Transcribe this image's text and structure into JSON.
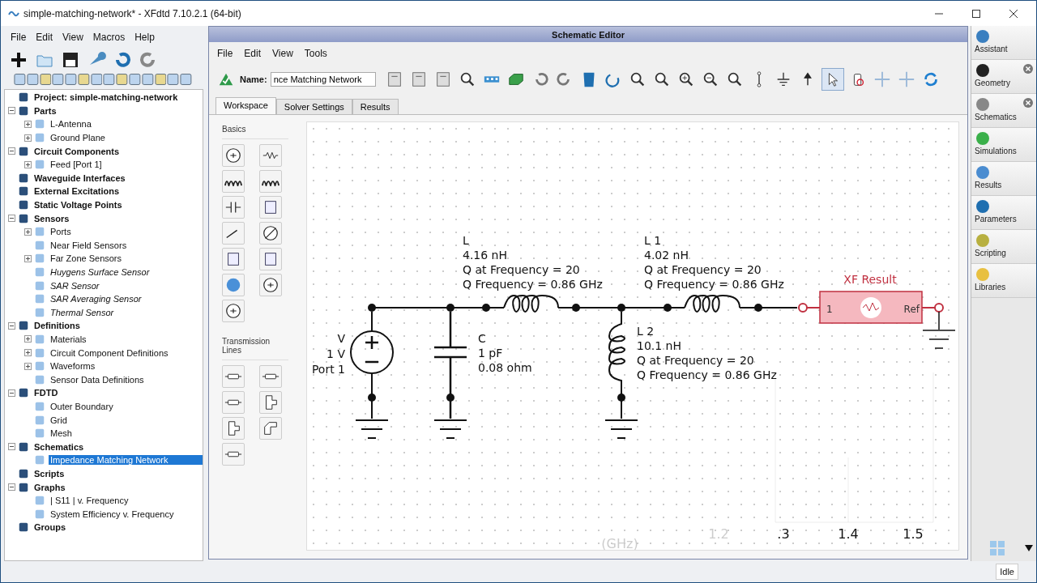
{
  "window": {
    "title": "simple-matching-network* - XFdtd 7.10.2.1 (64-bit)"
  },
  "menu": [
    "File",
    "Edit",
    "View",
    "Macros",
    "Help"
  ],
  "tree": [
    {
      "label": "Project: simple-matching-network",
      "selected": false
    },
    {
      "label": "Parts",
      "selected": false,
      "expanded": true,
      "children": [
        {
          "label": "L-Antenna",
          "selected": false,
          "expanded": false
        },
        {
          "label": "Ground Plane",
          "selected": false,
          "expanded": false
        }
      ]
    },
    {
      "label": "Circuit Components",
      "selected": false,
      "expanded": true,
      "children": [
        {
          "label": "Feed [Port 1]",
          "selected": false,
          "expanded": false
        }
      ]
    },
    {
      "label": "Waveguide Interfaces",
      "selected": false
    },
    {
      "label": "External Excitations",
      "selected": false
    },
    {
      "label": "Static Voltage Points",
      "selected": false
    },
    {
      "label": "Sensors",
      "selected": false,
      "expanded": true,
      "children": [
        {
          "label": "Ports",
          "selected": false,
          "italic": false,
          "expanded": false
        },
        {
          "label": "Near Field Sensors",
          "selected": false,
          "italic": false
        },
        {
          "label": "Far Zone Sensors",
          "selected": false,
          "italic": false,
          "expanded": false
        },
        {
          "label": "Huygens Surface Sensor",
          "selected": false,
          "italic": true
        },
        {
          "label": "SAR Sensor",
          "selected": false,
          "italic": true
        },
        {
          "label": "SAR Averaging Sensor",
          "selected": false,
          "italic": true
        },
        {
          "label": "Thermal Sensor",
          "selected": false,
          "italic": true
        }
      ]
    },
    {
      "label": "Definitions",
      "selected": false,
      "expanded": true,
      "children": [
        {
          "label": "Materials",
          "selected": false,
          "expanded": false
        },
        {
          "label": "Circuit Component Definitions",
          "selected": false,
          "expanded": false
        },
        {
          "label": "Waveforms",
          "selected": false,
          "expanded": false
        },
        {
          "label": "Sensor Data Definitions",
          "selected": false
        }
      ]
    },
    {
      "label": "FDTD",
      "selected": false,
      "expanded": true,
      "children": [
        {
          "label": "Outer Boundary",
          "selected": false
        },
        {
          "label": "Grid",
          "selected": false
        },
        {
          "label": "Mesh",
          "selected": false
        }
      ]
    },
    {
      "label": "Schematics",
      "selected": false,
      "expanded": true,
      "children": [
        {
          "label": "Impedance Matching Network",
          "selected": true
        }
      ]
    },
    {
      "label": "Scripts",
      "selected": false
    },
    {
      "label": "Graphs",
      "selected": false,
      "expanded": true,
      "children": [
        {
          "label": "| S11 | v. Frequency",
          "selected": false
        },
        {
          "label": "System Efficiency v. Frequency",
          "selected": false
        }
      ]
    },
    {
      "label": "Groups",
      "selected": false
    }
  ],
  "editor": {
    "title": "Schematic Editor",
    "menu": [
      "File",
      "Edit",
      "View",
      "Tools"
    ],
    "name_label": "Name:",
    "name_value": "nce Matching Network",
    "tabs": [
      {
        "label": "Workspace",
        "selected": true
      },
      {
        "label": "Solver Settings",
        "selected": false
      },
      {
        "label": "Results",
        "selected": false
      }
    ],
    "palette": [
      {
        "title": "Basics"
      },
      {
        "title": "Transmission Lines"
      }
    ],
    "components": [
      {
        "kind": "series-inductor",
        "lines": [
          "L",
          "4.16 nH",
          "Q at Frequency = 20",
          "Q Frequency = 0.86 GHz"
        ]
      },
      {
        "kind": "series-inductor-2",
        "lines": [
          "L 1",
          "4.02 nH",
          "Q at Frequency = 20",
          "Q Frequency = 0.86 GHz"
        ]
      },
      {
        "kind": "result",
        "title": "XF Result",
        "port": "1",
        "ref": "Ref"
      },
      {
        "kind": "source",
        "lines": [
          "V",
          "1 V",
          "Port 1"
        ]
      },
      {
        "kind": "capacitor",
        "lines": [
          "C",
          "1 pF",
          "0.08 ohm"
        ]
      },
      {
        "kind": "shunt-inductor",
        "lines": [
          "L 2",
          "10.1 nH",
          "Q at Frequency = 20",
          "Q Frequency = 0.86 GHz"
        ]
      }
    ],
    "ghost_labels": [
      {
        "text": "1.2",
        "faded": true
      },
      {
        "text": ".3",
        "faded": false
      },
      {
        "text": "1.4",
        "faded": false
      },
      {
        "text": "1.5",
        "faded": false
      },
      {
        "text": "(GHz)",
        "faded": true
      }
    ]
  },
  "sidebar": [
    {
      "label": "Assistant",
      "closable": false
    },
    {
      "label": "Geometry",
      "closable": true
    },
    {
      "label": "Schematics",
      "closable": true
    },
    {
      "label": "Simulations",
      "closable": false
    },
    {
      "label": "Results",
      "closable": false
    },
    {
      "label": "Parameters",
      "closable": false
    },
    {
      "label": "Scripting",
      "closable": false
    },
    {
      "label": "Libraries",
      "closable": false
    }
  ],
  "status": "Idle"
}
